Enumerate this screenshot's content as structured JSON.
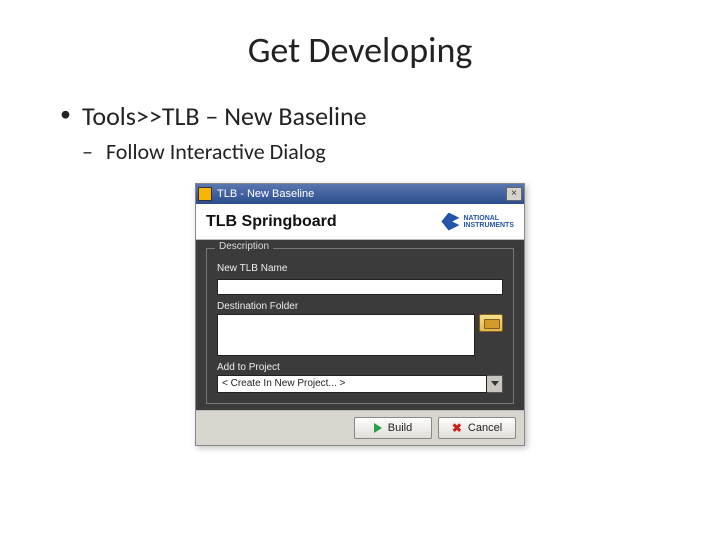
{
  "slide": {
    "title": "Get Developing",
    "bullet1": "Tools>>TLB – New Baseline",
    "sub1": "Follow Interactive Dialog"
  },
  "dialog": {
    "window_title": "TLB - New Baseline",
    "header_title": "TLB Springboard",
    "ni_line1": "NATIONAL",
    "ni_line2": "INSTRUMENTS",
    "group_legend": "Description",
    "name_label": "New TLB Name",
    "name_value": "",
    "folder_label": "Destination Folder",
    "folder_value": "",
    "project_label": "Add to Project",
    "project_value": "< Create In New Project... >",
    "build_label": "Build",
    "cancel_label": "Cancel"
  }
}
